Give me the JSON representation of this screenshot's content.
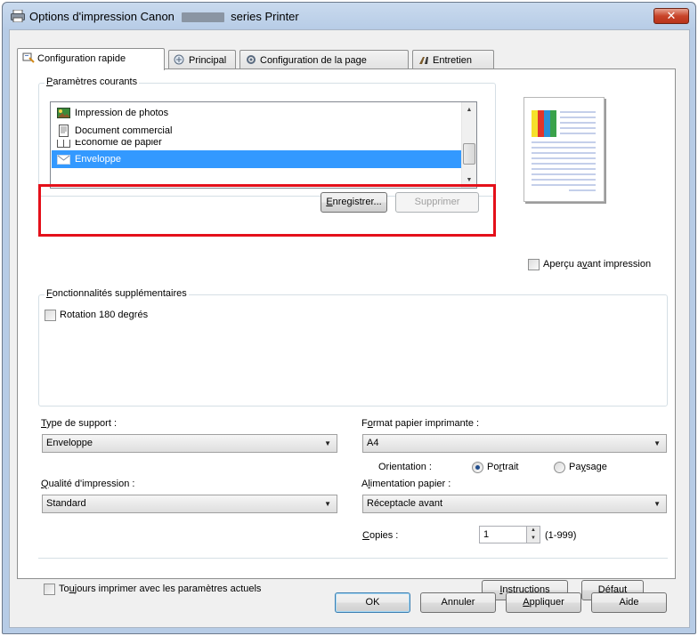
{
  "window": {
    "title_prefix": "Options d'impression Canon",
    "title_suffix": "series Printer",
    "close_label": "✕"
  },
  "tabs": [
    {
      "label": "Configuration rapide",
      "active": true
    },
    {
      "label": "Principal",
      "active": false
    },
    {
      "label": "Configuration de la page",
      "active": false
    },
    {
      "label": "Entretien",
      "active": false
    }
  ],
  "current_settings": {
    "group_label_accel": "P",
    "group_label_rest": "aramètres courants",
    "items": [
      {
        "label": "Impression de photos",
        "icon": "photo-icon"
      },
      {
        "label": "Document commercial",
        "icon": "document-icon"
      },
      {
        "label": "Économie de papier",
        "icon": "paper-saving-icon"
      },
      {
        "label": "Enveloppe",
        "icon": "envelope-icon",
        "selected": true
      }
    ],
    "save_button_accel": "E",
    "save_button_rest": "nregistrer...",
    "delete_button": "Supprimer"
  },
  "preview": {
    "checkbox_label_a": "Aperçu a",
    "checkbox_label_accel": "v",
    "checkbox_label_b": "ant impression",
    "checked": false
  },
  "additional_features": {
    "group_label_accel": "F",
    "group_label_rest": "onctionnalités supplémentaires",
    "rotate_label": "Rotation 180 degrés",
    "rotate_checked": false
  },
  "media_type": {
    "label_accel": "T",
    "label_rest": "ype de support :",
    "value": "Enveloppe"
  },
  "printer_paper_size": {
    "label_a": "F",
    "label_accel": "o",
    "label_b": "rmat papier imprimante :",
    "value": "A4"
  },
  "orientation": {
    "label": "Orientation :",
    "portrait_a": "Po",
    "portrait_accel": "r",
    "portrait_b": "trait",
    "landscape_a": "Pa",
    "landscape_accel": "y",
    "landscape_b": "sage",
    "selected": "portrait"
  },
  "print_quality": {
    "label_accel": "Q",
    "label_rest": "ualité d'impression :",
    "value": "Standard"
  },
  "paper_source": {
    "label_a": "A",
    "label_accel": "l",
    "label_b": "imentation papier :",
    "value": "Réceptacle avant"
  },
  "copies": {
    "label_accel": "C",
    "label_rest": "opies :",
    "value": "1",
    "range": "(1-999)"
  },
  "always_print": {
    "label_a": "To",
    "label_accel": "u",
    "label_b": "jours imprimer avec les paramètres actuels",
    "checked": false
  },
  "instructions_button_accel": "I",
  "instructions_button_rest": "nstructions",
  "default_button_accel": "D",
  "default_button_rest": "éfaut",
  "footer": {
    "ok": "OK",
    "cancel": "Annuler",
    "apply_accel": "A",
    "apply_rest": "ppliquer",
    "help": "Aide"
  },
  "colors": {
    "selection": "#3399ff",
    "highlight_box": "#e4101a",
    "titlebar": "#b7cce6"
  }
}
